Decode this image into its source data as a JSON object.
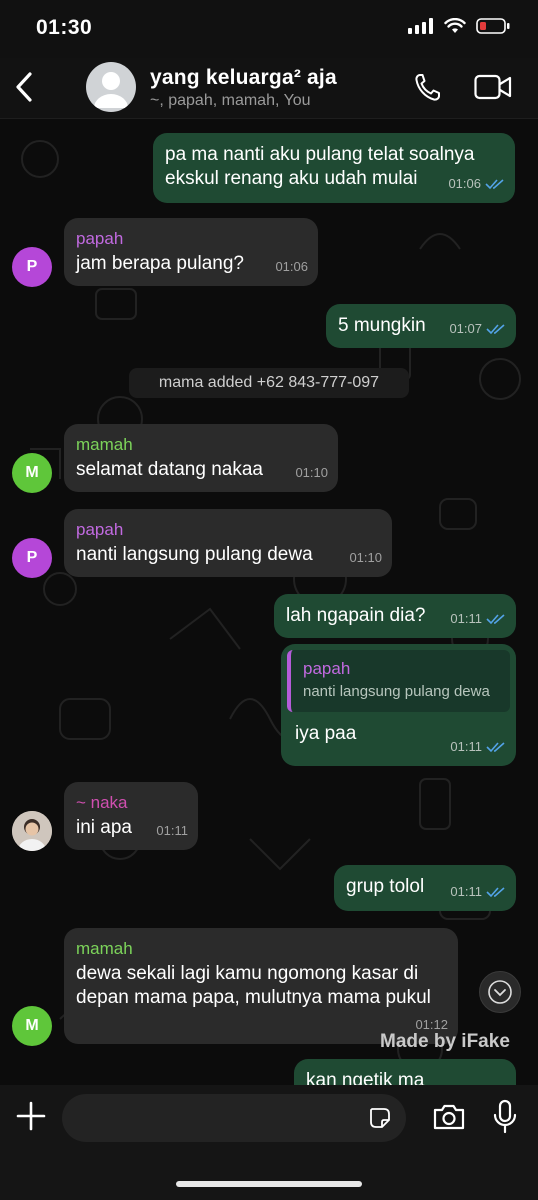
{
  "status": {
    "time": "01:30"
  },
  "header": {
    "title": "yang keluarga² aja",
    "subtitle": "~, papah, mamah, You"
  },
  "messages": [
    {
      "text": "pa ma nanti aku pulang telat soalnya ekskul renang aku udah mulai",
      "time": "01:06"
    },
    {
      "sender": "papah",
      "avatar": "P",
      "text": "jam berapa pulang?",
      "time": "01:06"
    },
    {
      "text": "5 mungkin",
      "time": "01:07"
    },
    {
      "sender": "mamah",
      "avatar": "M",
      "text": "selamat datang nakaa",
      "time": "01:10"
    },
    {
      "sender": "papah",
      "avatar": "P",
      "text": "nanti langsung pulang dewa",
      "time": "01:10"
    },
    {
      "text": "lah ngapain dia?",
      "time": "01:11"
    },
    {
      "quote_name": "papah",
      "quote_text": "nanti langsung pulang dewa",
      "text": "iya paa",
      "time": "01:11"
    },
    {
      "sender": "~ naka",
      "text": "ini apa",
      "time": "01:11"
    },
    {
      "text": "grup tolol",
      "time": "01:11"
    },
    {
      "sender": "mamah",
      "avatar": "M",
      "text": "dewa sekali lagi kamu ngomong kasar di depan mama papa, mulutnya mama pukul",
      "time": "01:12"
    },
    {
      "text": "kan ngetik ma"
    }
  ],
  "system_message": "mama added +62 843-777-097",
  "watermark": "Made by iFake",
  "input": {
    "placeholder": ""
  },
  "colors": {
    "outgoing": "#1f4a33",
    "incoming": "#2b2b2b",
    "papah": "#c16ae0",
    "mamah": "#7cd35a",
    "naka": "#d04fb0",
    "ticks": "#53a3e8"
  }
}
